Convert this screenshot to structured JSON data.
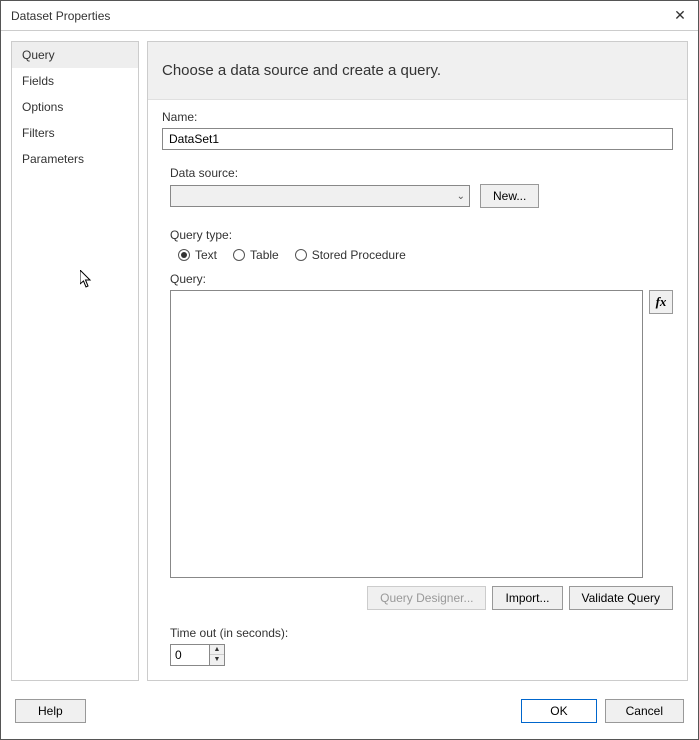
{
  "window": {
    "title": "Dataset Properties"
  },
  "sidebar": {
    "items": [
      {
        "label": "Query"
      },
      {
        "label": "Fields"
      },
      {
        "label": "Options"
      },
      {
        "label": "Filters"
      },
      {
        "label": "Parameters"
      }
    ],
    "active_index": 0
  },
  "header": {
    "text": "Choose a data source and create a query."
  },
  "form": {
    "name_label": "Name:",
    "name_value": "DataSet1",
    "datasource_label": "Data source:",
    "datasource_value": "",
    "new_button": "New...",
    "querytype_label": "Query type:",
    "querytype_options": [
      {
        "label": "Text",
        "checked": true
      },
      {
        "label": "Table",
        "checked": false
      },
      {
        "label": "Stored Procedure",
        "checked": false
      }
    ],
    "query_label": "Query:",
    "query_value": "",
    "fx_label": "fx",
    "query_designer_button": "Query Designer...",
    "import_button": "Import...",
    "validate_button": "Validate Query",
    "timeout_label": "Time out (in seconds):",
    "timeout_value": "0"
  },
  "footer": {
    "help": "Help",
    "ok": "OK",
    "cancel": "Cancel"
  }
}
